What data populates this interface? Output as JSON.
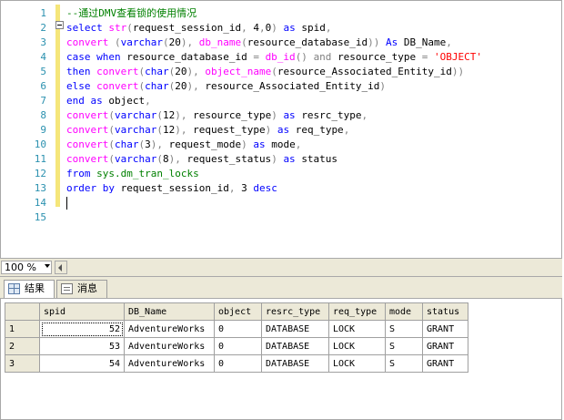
{
  "editor": {
    "line_numbers": [
      "1",
      "2",
      "3",
      "4",
      "5",
      "6",
      "7",
      "8",
      "9",
      "10",
      "11",
      "12",
      "13",
      "14",
      "15"
    ],
    "lines": [
      [
        {
          "t": "cm",
          "v": "--通过DMV查看锁的使用情况"
        }
      ],
      [
        {
          "t": "kw",
          "v": "select "
        },
        {
          "t": "fn",
          "v": "str"
        },
        {
          "t": "op",
          "v": "("
        },
        {
          "t": "plain",
          "v": "request_session_id"
        },
        {
          "t": "op",
          "v": ", "
        },
        {
          "t": "plain",
          "v": "4"
        },
        {
          "t": "op",
          "v": ","
        },
        {
          "t": "plain",
          "v": "0"
        },
        {
          "t": "op",
          "v": ") "
        },
        {
          "t": "kw",
          "v": "as "
        },
        {
          "t": "plain",
          "v": "spid"
        },
        {
          "t": "op",
          "v": ","
        }
      ],
      [
        {
          "t": "fn",
          "v": "convert "
        },
        {
          "t": "op",
          "v": "("
        },
        {
          "t": "kw",
          "v": "varchar"
        },
        {
          "t": "op",
          "v": "("
        },
        {
          "t": "plain",
          "v": "20"
        },
        {
          "t": "op",
          "v": "), "
        },
        {
          "t": "fn",
          "v": "db_name"
        },
        {
          "t": "op",
          "v": "("
        },
        {
          "t": "plain",
          "v": "resource_database_id"
        },
        {
          "t": "op",
          "v": ")) "
        },
        {
          "t": "kw",
          "v": "As "
        },
        {
          "t": "plain",
          "v": "DB_Name"
        },
        {
          "t": "op",
          "v": ","
        }
      ],
      [
        {
          "t": "kw",
          "v": "case when "
        },
        {
          "t": "plain",
          "v": "resource_database_id "
        },
        {
          "t": "op",
          "v": "= "
        },
        {
          "t": "fn",
          "v": "db_id"
        },
        {
          "t": "op",
          "v": "() "
        },
        {
          "t": "op",
          "v": "and "
        },
        {
          "t": "plain",
          "v": "resource_type "
        },
        {
          "t": "op",
          "v": "= "
        },
        {
          "t": "str",
          "v": "'OBJECT'"
        }
      ],
      [
        {
          "t": "kw",
          "v": "then "
        },
        {
          "t": "fn",
          "v": "convert"
        },
        {
          "t": "op",
          "v": "("
        },
        {
          "t": "kw",
          "v": "char"
        },
        {
          "t": "op",
          "v": "("
        },
        {
          "t": "plain",
          "v": "20"
        },
        {
          "t": "op",
          "v": "), "
        },
        {
          "t": "fn",
          "v": "object_name"
        },
        {
          "t": "op",
          "v": "("
        },
        {
          "t": "plain",
          "v": "resource_Associated_Entity_id"
        },
        {
          "t": "op",
          "v": "))"
        }
      ],
      [
        {
          "t": "kw",
          "v": "else "
        },
        {
          "t": "fn",
          "v": "convert"
        },
        {
          "t": "op",
          "v": "("
        },
        {
          "t": "kw",
          "v": "char"
        },
        {
          "t": "op",
          "v": "("
        },
        {
          "t": "plain",
          "v": "20"
        },
        {
          "t": "op",
          "v": "), "
        },
        {
          "t": "plain",
          "v": "resource_Associated_Entity_id"
        },
        {
          "t": "op",
          "v": ")"
        }
      ],
      [
        {
          "t": "kw",
          "v": "end as "
        },
        {
          "t": "plain",
          "v": "object"
        },
        {
          "t": "op",
          "v": ","
        }
      ],
      [
        {
          "t": "fn",
          "v": "convert"
        },
        {
          "t": "op",
          "v": "("
        },
        {
          "t": "kw",
          "v": "varchar"
        },
        {
          "t": "op",
          "v": "("
        },
        {
          "t": "plain",
          "v": "12"
        },
        {
          "t": "op",
          "v": "), "
        },
        {
          "t": "plain",
          "v": "resource_type"
        },
        {
          "t": "op",
          "v": ") "
        },
        {
          "t": "kw",
          "v": "as "
        },
        {
          "t": "plain",
          "v": "resrc_type"
        },
        {
          "t": "op",
          "v": ","
        }
      ],
      [
        {
          "t": "fn",
          "v": "convert"
        },
        {
          "t": "op",
          "v": "("
        },
        {
          "t": "kw",
          "v": "varchar"
        },
        {
          "t": "op",
          "v": "("
        },
        {
          "t": "plain",
          "v": "12"
        },
        {
          "t": "op",
          "v": "), "
        },
        {
          "t": "plain",
          "v": "request_type"
        },
        {
          "t": "op",
          "v": ") "
        },
        {
          "t": "kw",
          "v": "as "
        },
        {
          "t": "plain",
          "v": "req_type"
        },
        {
          "t": "op",
          "v": ","
        }
      ],
      [
        {
          "t": "fn",
          "v": "convert"
        },
        {
          "t": "op",
          "v": "("
        },
        {
          "t": "kw",
          "v": "char"
        },
        {
          "t": "op",
          "v": "("
        },
        {
          "t": "plain",
          "v": "3"
        },
        {
          "t": "op",
          "v": "), "
        },
        {
          "t": "plain",
          "v": "request_mode"
        },
        {
          "t": "op",
          "v": ") "
        },
        {
          "t": "kw",
          "v": "as "
        },
        {
          "t": "plain",
          "v": "mode"
        },
        {
          "t": "op",
          "v": ","
        }
      ],
      [
        {
          "t": "fn",
          "v": "convert"
        },
        {
          "t": "op",
          "v": "("
        },
        {
          "t": "kw",
          "v": "varchar"
        },
        {
          "t": "op",
          "v": "("
        },
        {
          "t": "plain",
          "v": "8"
        },
        {
          "t": "op",
          "v": "), "
        },
        {
          "t": "plain",
          "v": "request_status"
        },
        {
          "t": "op",
          "v": ") "
        },
        {
          "t": "kw",
          "v": "as "
        },
        {
          "t": "plain",
          "v": "status"
        }
      ],
      [
        {
          "t": "kw",
          "v": "from "
        },
        {
          "t": "sys",
          "v": "sys.dm_tran_locks"
        }
      ],
      [
        {
          "t": "kw",
          "v": "order by "
        },
        {
          "t": "plain",
          "v": "request_session_id"
        },
        {
          "t": "op",
          "v": ", "
        },
        {
          "t": "plain",
          "v": "3 "
        },
        {
          "t": "kw",
          "v": "desc"
        }
      ],
      [],
      []
    ]
  },
  "zoom": {
    "value": "100 %"
  },
  "tabs": {
    "results": "结果",
    "messages": "消息"
  },
  "grid": {
    "columns": [
      "spid",
      "DB_Name",
      "object",
      "resrc_type",
      "req_type",
      "mode",
      "status"
    ],
    "rows": [
      {
        "n": "1",
        "cells": [
          "52",
          "AdventureWorks",
          "0",
          "DATABASE",
          "LOCK",
          "S",
          "GRANT"
        ]
      },
      {
        "n": "2",
        "cells": [
          "53",
          "AdventureWorks",
          "0",
          "DATABASE",
          "LOCK",
          "S",
          "GRANT"
        ]
      },
      {
        "n": "3",
        "cells": [
          "54",
          "AdventureWorks",
          "0",
          "DATABASE",
          "LOCK",
          "S",
          "GRANT"
        ]
      }
    ]
  },
  "colors": {
    "keyword": "#0000ff",
    "function": "#ff00ff",
    "string": "#ff0000",
    "comment": "#008000",
    "line_number": "#2b91af"
  }
}
